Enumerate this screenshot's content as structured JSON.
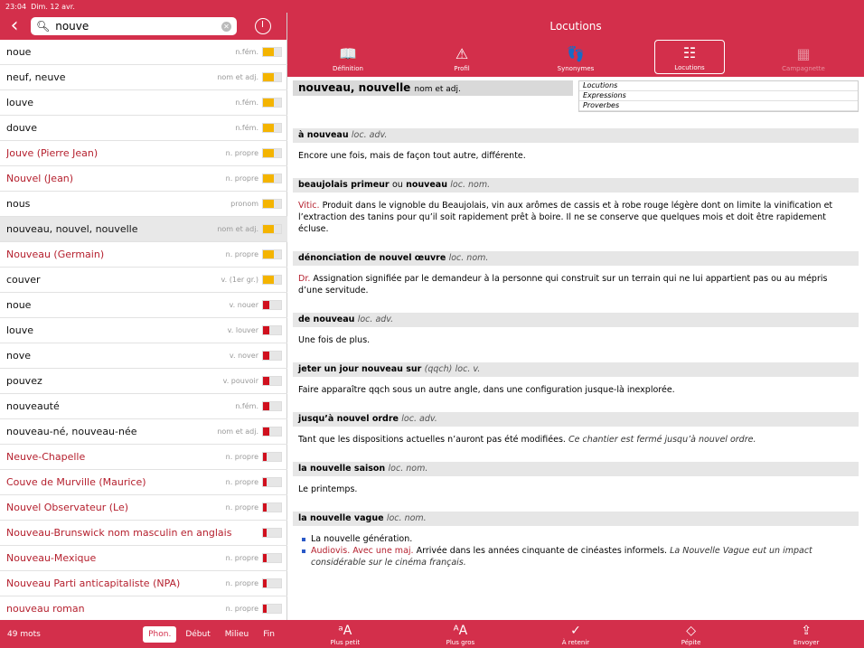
{
  "status": {
    "time": "23:04",
    "date": "Dim. 12 avr.",
    "battery": "22 %"
  },
  "search": {
    "value": "nouve"
  },
  "list": [
    {
      "w": "noue",
      "c": "n.fém.",
      "lvl": 3,
      "red": false
    },
    {
      "w": "neuf, neuve",
      "c": "nom et adj.",
      "lvl": 3,
      "red": false
    },
    {
      "w": "louve",
      "c": "n.fém.",
      "lvl": 3,
      "red": false
    },
    {
      "w": "douve",
      "c": "n.fém.",
      "lvl": 3,
      "red": false
    },
    {
      "w": "Jouve (Pierre Jean)",
      "c": "n. propre",
      "lvl": 3,
      "red": true
    },
    {
      "w": "Nouvel (Jean)",
      "c": "n. propre",
      "lvl": 3,
      "red": true
    },
    {
      "w": "nous",
      "c": "pronom",
      "lvl": 3,
      "red": false
    },
    {
      "w": "nouveau, nouvel, nouvelle",
      "c": "nom et adj.",
      "lvl": 3,
      "red": false,
      "sel": true
    },
    {
      "w": "Nouveau (Germain)",
      "c": "n. propre",
      "lvl": 3,
      "red": true
    },
    {
      "w": "couver",
      "c": "v. (1er gr.)",
      "lvl": 3,
      "red": false
    },
    {
      "w": "noue",
      "c": "v. nouer",
      "lvl": 2,
      "red": false
    },
    {
      "w": "louve",
      "c": "v. louver",
      "lvl": 2,
      "red": false
    },
    {
      "w": "nove",
      "c": "v. nover",
      "lvl": 2,
      "red": false
    },
    {
      "w": "pouvez",
      "c": "v. pouvoir",
      "lvl": 2,
      "red": false
    },
    {
      "w": "nouveauté",
      "c": "n.fém.",
      "lvl": 2,
      "red": false
    },
    {
      "w": "nouveau-né, nouveau-née",
      "c": "nom et adj.",
      "lvl": 2,
      "red": false
    },
    {
      "w": "Neuve-Chapelle",
      "c": "n. propre",
      "lvl": 1,
      "red": true
    },
    {
      "w": "Couve de Murville (Maurice)",
      "c": "n. propre",
      "lvl": 1,
      "red": true
    },
    {
      "w": "Nouvel Observateur (Le)",
      "c": "n. propre",
      "lvl": 1,
      "red": true
    },
    {
      "w": "Nouveau-Brunswick nom masculin en anglais",
      "c": "",
      "lvl": 1,
      "red": true
    },
    {
      "w": "Nouveau-Mexique",
      "c": "n. propre",
      "lvl": 1,
      "red": true
    },
    {
      "w": "Nouveau Parti anticapitaliste (NPA)",
      "c": "n. propre",
      "lvl": 1,
      "red": true
    },
    {
      "w": "nouveau roman",
      "c": "n. propre",
      "lvl": 1,
      "red": true
    }
  ],
  "left_footer": {
    "count": "49 mots",
    "seg": [
      "Phon.",
      "Début",
      "Milieu",
      "Fin"
    ]
  },
  "right": {
    "title": "Locutions",
    "tabs": [
      {
        "l": "Définition",
        "i": "📖"
      },
      {
        "l": "Profil",
        "i": "⚠"
      },
      {
        "l": "Synonymes",
        "i": "👣"
      },
      {
        "l": "Locutions",
        "i": "☷"
      },
      {
        "l": "Campagnette",
        "i": "▦"
      }
    ],
    "headword": "nouveau, nouvelle",
    "hwcat": "nom et adj.",
    "subnav": [
      "Locutions",
      "Expressions",
      "Proverbes"
    ],
    "sections": [
      {
        "h": "à nouveau",
        "cat": "loc. adv.",
        "d": "Encore une fois, mais de façon tout autre, différente."
      },
      {
        "h": "beaujolais primeur",
        "ou": "ou",
        "h2": "nouveau",
        "cat": "loc. nom.",
        "dom": "Vitic.",
        "d": "Produit dans le vignoble du Beaujolais, vin aux arômes de cassis et à robe rouge légère dont on limite la vinification et l’extraction des tanins pour qu’il soit rapidement prêt à boire. Il ne se conserve que quelques mois et doit être rapidement écluse."
      },
      {
        "h": "dénonciation de nouvel œuvre",
        "cat": "loc. nom.",
        "dom": "Dr.",
        "d": "Assignation signifiée par le demandeur à la personne qui construit sur un terrain qui ne lui appartient pas ou au mépris d’une servitude."
      },
      {
        "h": "de nouveau",
        "cat": "loc. adv.",
        "d": "Une fois de plus."
      },
      {
        "h": "jeter un jour nouveau sur",
        "pre": "(qqch)",
        "cat": "loc. v.",
        "d": "Faire apparaître qqch sous un autre angle, dans une configuration jusque-là inexplorée."
      },
      {
        "h": "jusqu’à nouvel ordre",
        "cat": "loc. adv.",
        "d": "Tant que les dispositions actuelles n’auront pas été modifiées.",
        "ex": "Ce chantier est fermé jusqu’à nouvel ordre."
      },
      {
        "h": "la nouvelle saison",
        "cat": "loc. nom.",
        "d": "Le printemps."
      },
      {
        "h": "la nouvelle vague",
        "cat": "loc. nom.",
        "b1": "La nouvelle génération.",
        "bdom": "Audiovis. Avec une maj.",
        "b2": "Arrivée dans les années cinquante de cinéastes informels.",
        "bex": "La Nouvelle Vague eut un impact considérable sur le cinéma français."
      }
    ],
    "footer": [
      {
        "l": "Plus petit",
        "i": "ᵃA"
      },
      {
        "l": "Plus gros",
        "i": "ᴬA"
      },
      {
        "l": "À retenir",
        "i": "✓"
      },
      {
        "l": "Pépite",
        "i": "◇"
      },
      {
        "l": "Envoyer",
        "i": "⇪"
      }
    ]
  },
  "colors": {
    "brand": "#d32f4b",
    "yellow": "#f4b400",
    "red": "#d0101e"
  }
}
